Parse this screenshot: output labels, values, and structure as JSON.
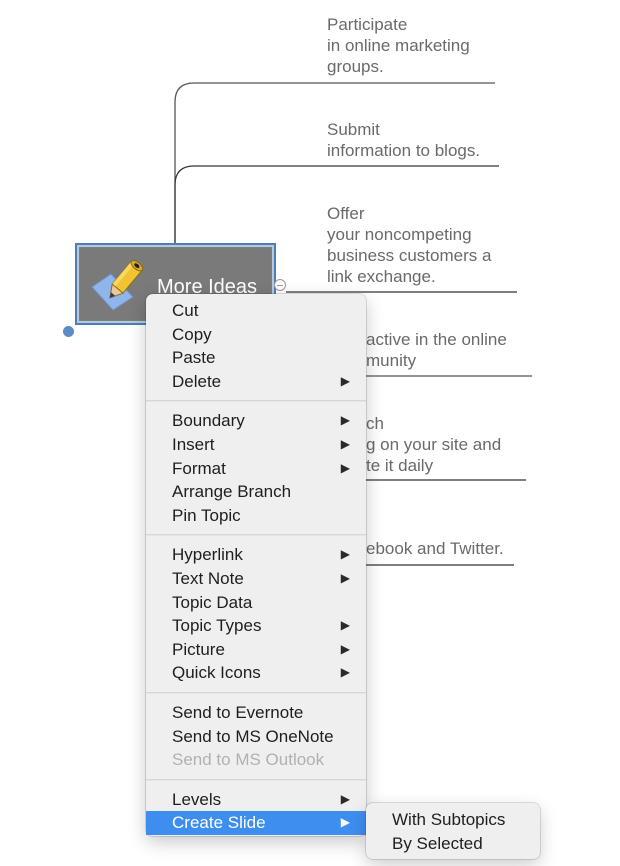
{
  "mindmap": {
    "central_topic": {
      "label": "More Ideas",
      "icon": "pencil-note-icon"
    },
    "subtopics": [
      {
        "text": "Participate\nin online marketing\ngroups."
      },
      {
        "text": "Submit\ninformation to blogs."
      },
      {
        "text": "Offer\nyour noncompeting\nbusiness customers a\nlink exchange."
      },
      {
        "text": "active in the online\nmunity"
      },
      {
        "text": "ch\ng on your site and\nte it daily"
      },
      {
        "text": "ebook and Twitter."
      }
    ]
  },
  "context_menu": {
    "groups": [
      [
        {
          "label": "Cut",
          "submenu": false
        },
        {
          "label": "Copy",
          "submenu": false
        },
        {
          "label": "Paste",
          "submenu": false
        },
        {
          "label": "Delete",
          "submenu": true
        }
      ],
      [
        {
          "label": "Boundary",
          "submenu": true
        },
        {
          "label": "Insert",
          "submenu": true
        },
        {
          "label": "Format",
          "submenu": true
        },
        {
          "label": "Arrange Branch",
          "submenu": false
        },
        {
          "label": "Pin Topic",
          "submenu": false
        }
      ],
      [
        {
          "label": "Hyperlink",
          "submenu": true
        },
        {
          "label": "Text Note",
          "submenu": true
        },
        {
          "label": "Topic Data",
          "submenu": false
        },
        {
          "label": "Topic Types",
          "submenu": true
        },
        {
          "label": "Picture",
          "submenu": true
        },
        {
          "label": "Quick Icons",
          "submenu": true
        }
      ],
      [
        {
          "label": "Send to Evernote",
          "submenu": false
        },
        {
          "label": "Send to MS OneNote",
          "submenu": false
        },
        {
          "label": "Send to MS Outlook",
          "submenu": false,
          "disabled": true
        }
      ],
      [
        {
          "label": "Levels",
          "submenu": true
        },
        {
          "label": "Create Slide",
          "submenu": true,
          "highlighted": true
        }
      ]
    ],
    "arrow_glyph": "▶"
  },
  "create_slide_submenu": {
    "items": [
      {
        "label": "With Subtopics"
      },
      {
        "label": "By Selected"
      }
    ]
  },
  "colors": {
    "highlight": "#3e8ef0",
    "topic_fill": "#7a7a7a",
    "topic_border": "#4d7fb6",
    "subtopic_text": "#6a6a6a",
    "disabled_text": "#b1b1b1"
  }
}
